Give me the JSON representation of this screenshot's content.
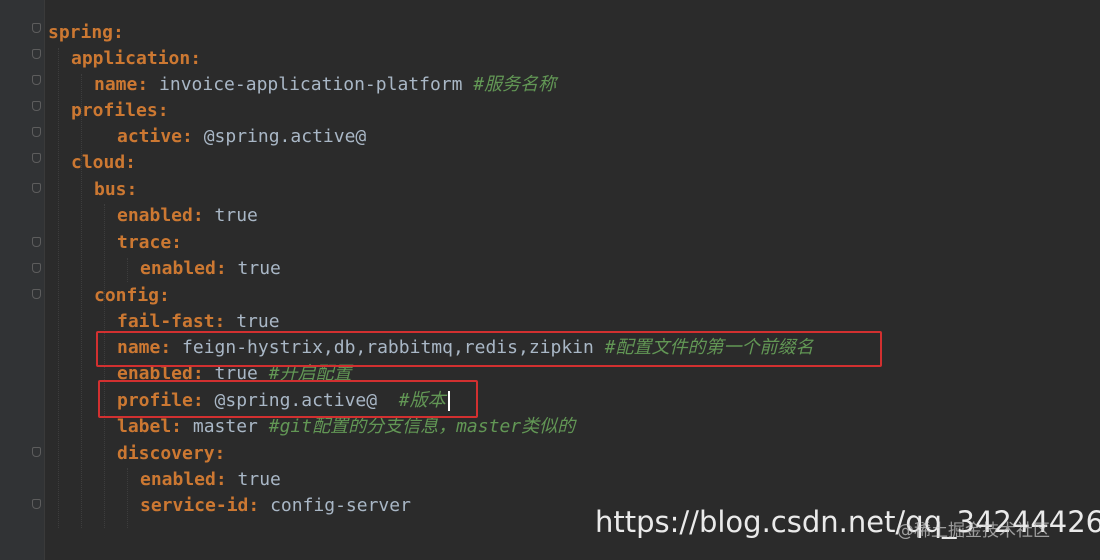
{
  "lines": [
    {
      "key": "spring:",
      "value": "",
      "comment": ""
    },
    {
      "key": "application:",
      "value": "",
      "comment": ""
    },
    {
      "key": "name:",
      "value": "invoice-application-platform",
      "comment": "#服务名称"
    },
    {
      "key": "profiles:",
      "value": "",
      "comment": ""
    },
    {
      "key": "active:",
      "value": "@spring.active@",
      "comment": ""
    },
    {
      "key": "cloud:",
      "value": "",
      "comment": ""
    },
    {
      "key": "bus:",
      "value": "",
      "comment": ""
    },
    {
      "key": "enabled:",
      "value": "true",
      "comment": ""
    },
    {
      "key": "trace:",
      "value": "",
      "comment": ""
    },
    {
      "key": "enabled:",
      "value": "true",
      "comment": ""
    },
    {
      "key": "config:",
      "value": "",
      "comment": ""
    },
    {
      "key": "fail-fast:",
      "value": "true",
      "comment": ""
    },
    {
      "key": "name:",
      "value": "feign-hystrix,db,rabbitmq,redis,zipkin",
      "comment": "#配置文件的第一个前缀名"
    },
    {
      "key": "enabled:",
      "value": "true",
      "comment": "#开启配置"
    },
    {
      "key": "profile:",
      "value": "@spring.active@",
      "comment": "#版本"
    },
    {
      "key": "label:",
      "value": "master",
      "comment": "#git配置的分支信息，master类似的"
    },
    {
      "key": "discovery:",
      "value": "",
      "comment": ""
    },
    {
      "key": "enabled:",
      "value": "true",
      "comment": ""
    },
    {
      "key": "service-id:",
      "value": "config-server",
      "comment": ""
    }
  ],
  "watermark": {
    "url": "https://blog.csdn.net/qq_34244426",
    "overlay": "@稀土掘金技术社区"
  },
  "colors": {
    "background": "#2b2b2b",
    "key": "#cc7832",
    "value": "#a9b7c6",
    "comment": "#629755",
    "highlight": "#d23030"
  }
}
